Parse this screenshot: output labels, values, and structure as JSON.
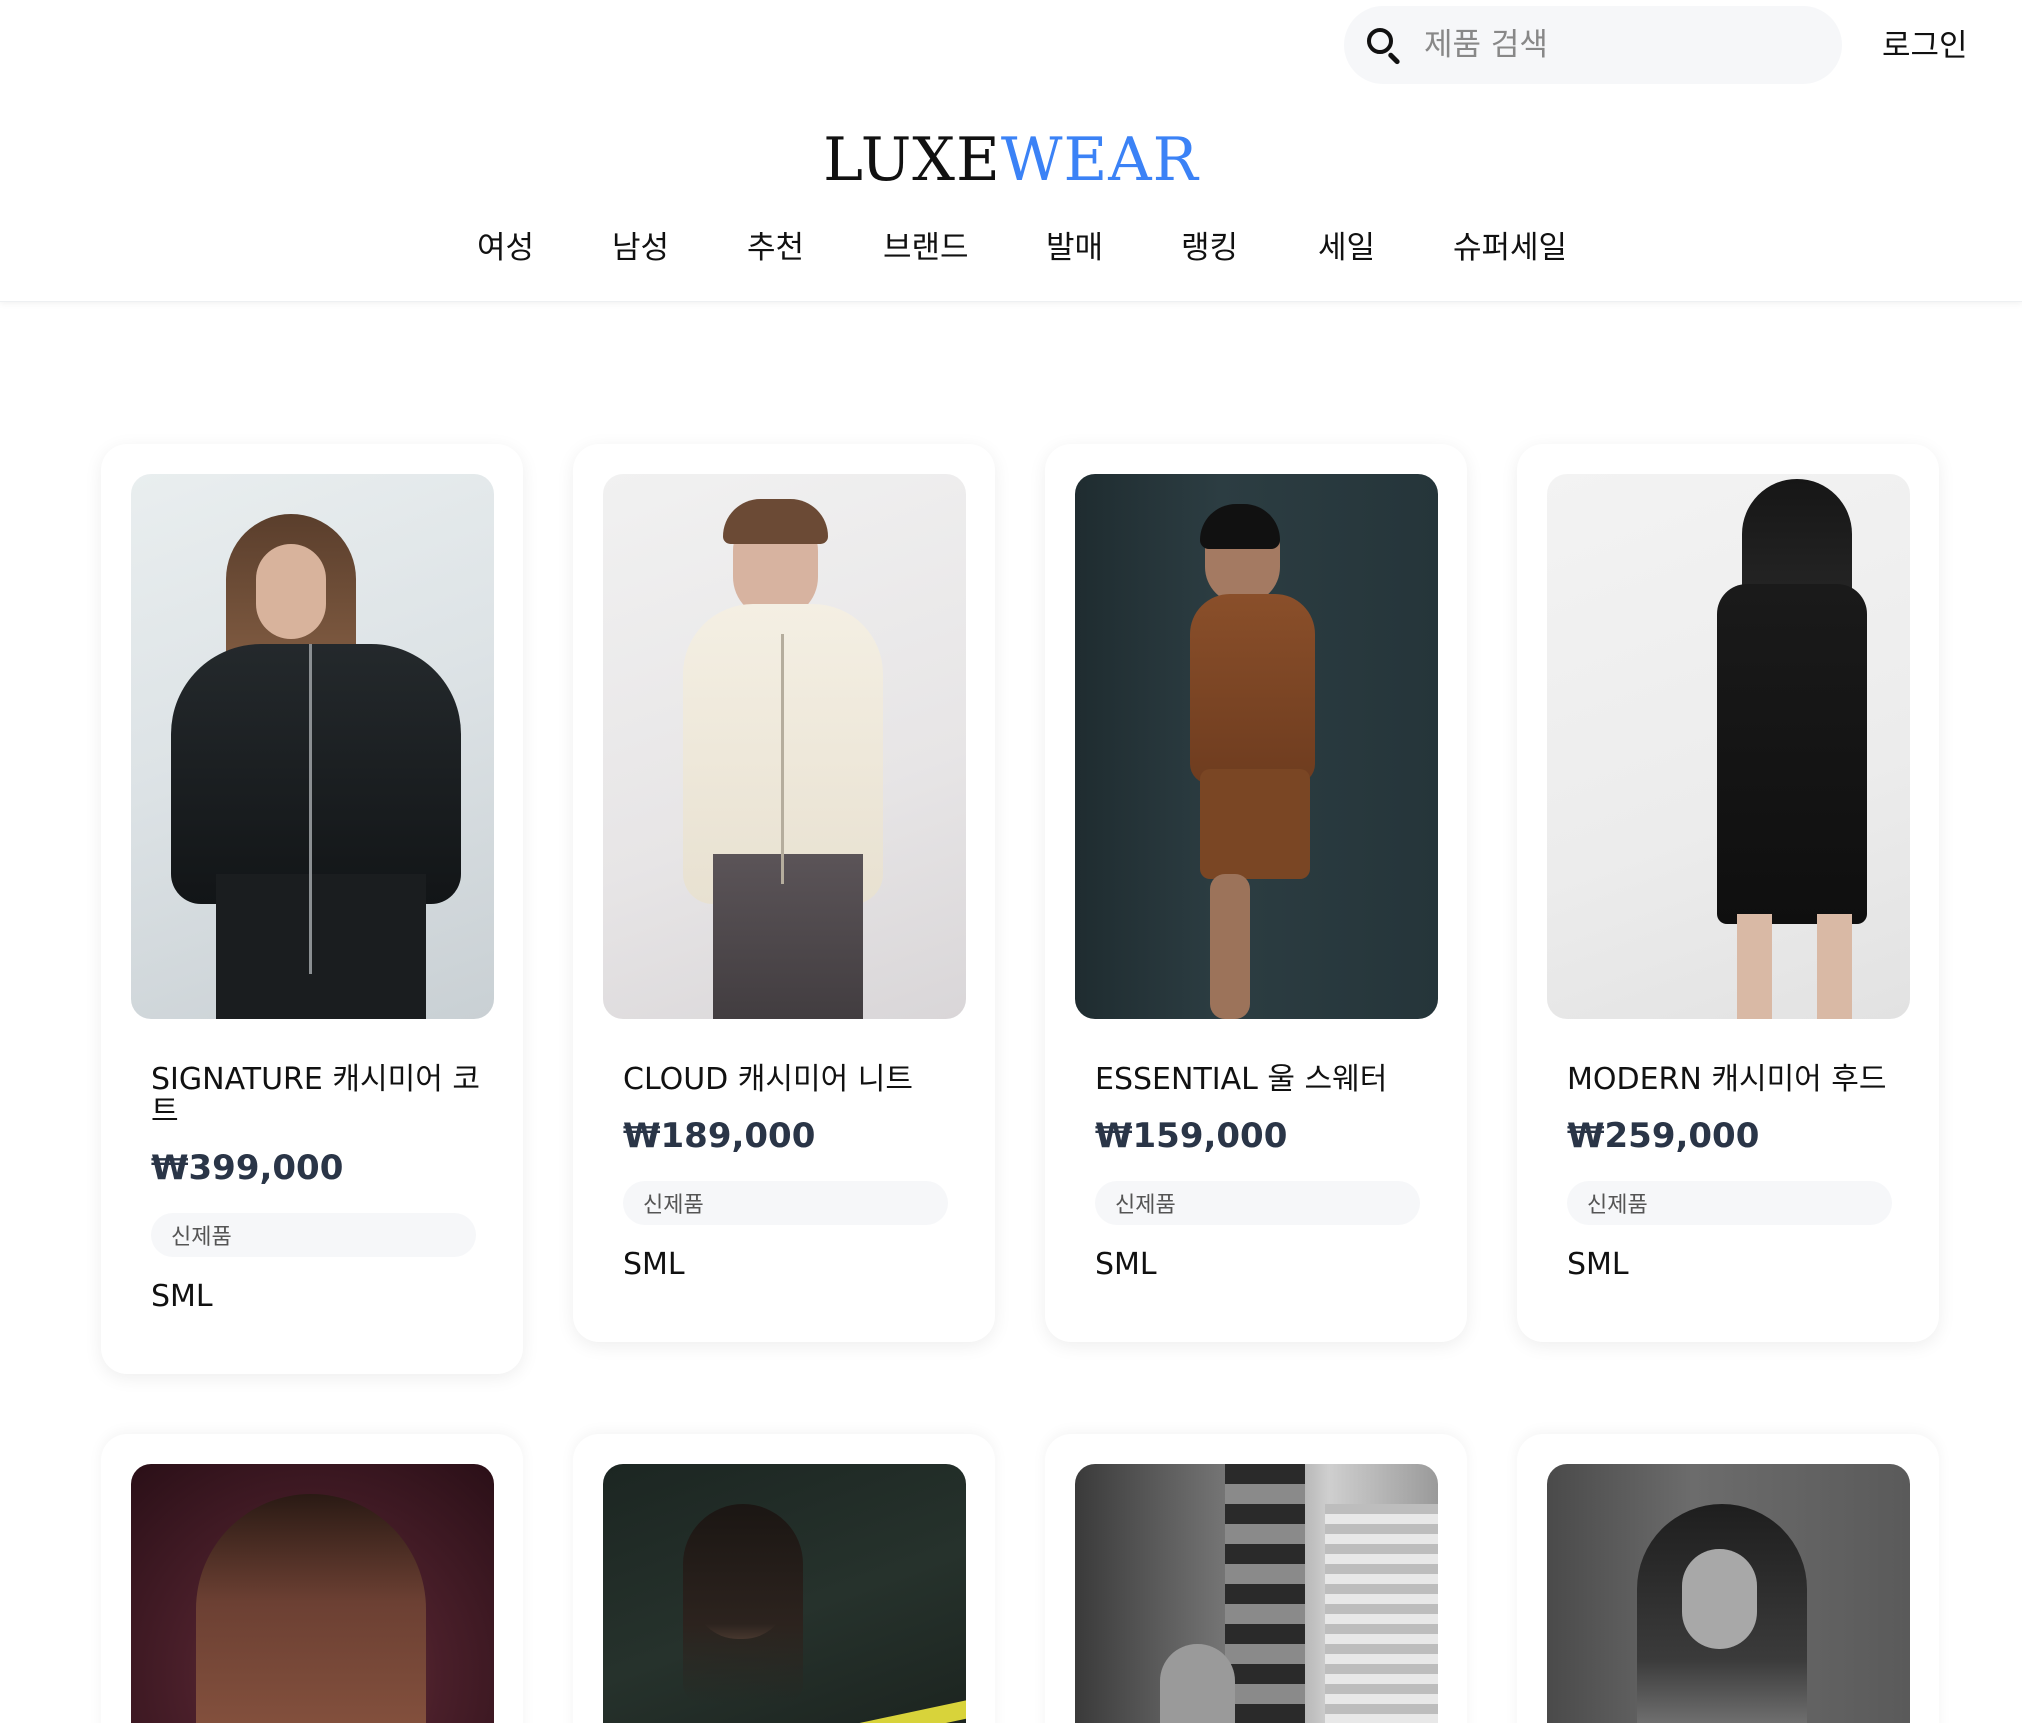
{
  "header": {
    "search_placeholder": "제품 검색",
    "login_label": "로그인",
    "logo_part1": "LUXE",
    "logo_part2": "WEAR",
    "nav": [
      "여성",
      "남성",
      "추천",
      "브랜드",
      "발매",
      "랭킹",
      "세일",
      "슈퍼세일"
    ]
  },
  "products": [
    {
      "name": "SIGNATURE 캐시미어 코트",
      "price": "₩399,000",
      "badge": "신제품",
      "sizes": "SML"
    },
    {
      "name": "CLOUD 캐시미어 니트",
      "price": "₩189,000",
      "badge": "신제품",
      "sizes": "SML"
    },
    {
      "name": "ESSENTIAL 울 스웨터",
      "price": "₩159,000",
      "badge": "신제품",
      "sizes": "SML"
    },
    {
      "name": "MODERN 캐시미어 후드",
      "price": "₩259,000",
      "badge": "신제품",
      "sizes": "SML"
    }
  ],
  "colors": {
    "accent": "#3b82f6",
    "price": "#2a3547",
    "badge_bg": "#f6f7f9"
  }
}
